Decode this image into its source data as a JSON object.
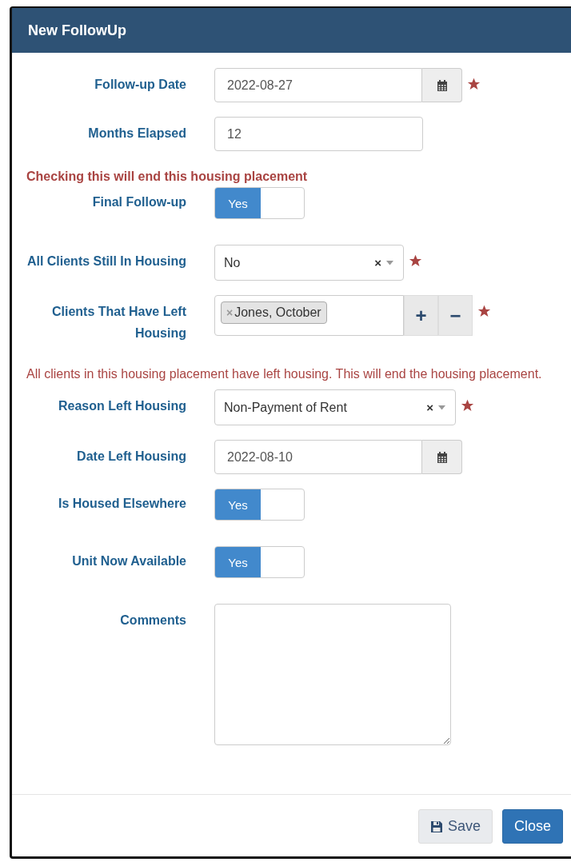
{
  "dialog": {
    "title": "New FollowUp"
  },
  "form": [
    {
      "kind": "date",
      "label": "Follow-up Date",
      "value": "2022-08-27",
      "required": true
    },
    {
      "kind": "text",
      "label": "Months Elapsed",
      "value": "12",
      "required": false
    },
    {
      "kind": "note",
      "text": "Checking this will end this housing placement",
      "bold": true
    },
    {
      "kind": "toggle",
      "label": "Final Follow-up",
      "on_label": "Yes",
      "on": true
    },
    {
      "kind": "select",
      "label": "All Clients Still In Housing",
      "value": "No",
      "clear": "×",
      "required": true
    },
    {
      "kind": "multiselect",
      "label": "Clients That Have Left Housing",
      "tags": [
        {
          "remove": "×",
          "text": "Jones, October"
        }
      ],
      "add": "+",
      "minus": "−",
      "required": true
    },
    {
      "kind": "note",
      "text": "All clients in this housing placement have left housing. This will end the housing placement.",
      "bold": false
    },
    {
      "kind": "select",
      "label": "Reason Left Housing",
      "value": "Non-Payment of Rent",
      "clear": "×",
      "required": true,
      "wide": true
    },
    {
      "kind": "date",
      "label": "Date Left Housing",
      "value": "2022-08-10",
      "required": false
    },
    {
      "kind": "toggle",
      "label": "Is Housed Elsewhere",
      "on_label": "Yes",
      "on": true
    },
    {
      "kind": "toggle",
      "label": "Unit Now Available",
      "on_label": "Yes",
      "on": true
    },
    {
      "kind": "textarea",
      "label": "Comments"
    }
  ],
  "buttons": [
    {
      "kind": "save",
      "label": "Save"
    },
    {
      "kind": "close",
      "label": "Close"
    }
  ]
}
